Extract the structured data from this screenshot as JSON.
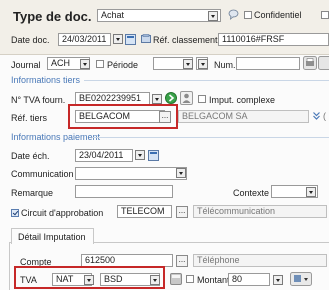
{
  "header": {
    "title": "Type de doc.",
    "doc_type_value": "Achat",
    "confidential_label": "Confidentiel",
    "date_doc_label": "Date doc.",
    "date_doc_value": "24/03/2011",
    "ref_classement_label": "Réf. classement",
    "ref_classement_value": "1110016#FRSF"
  },
  "journal_row": {
    "journal_label": "Journal",
    "journal_value": "ACH",
    "periode_label": "Période",
    "num_label": "Num."
  },
  "tiers": {
    "section_label": "Informations tiers",
    "tva_label": "N° TVA fourn.",
    "tva_value": "BE0202239951",
    "imput_label": "Imput. complexe",
    "ref_label": "Réf. tiers",
    "ref_value": "BELGACOM",
    "ref_name": "BELGACOM SA"
  },
  "paiement": {
    "section_label": "Informations paiement",
    "date_ech_label": "Date éch.",
    "date_ech_value": "23/04/2011",
    "communication_label": "Communication",
    "remarque_label": "Remarque",
    "contexte_label": "Contexte",
    "circuit_label": "Circuit d'approbation",
    "circuit_value": "TELECOM",
    "circuit_desc": "Télécommunication"
  },
  "imputation": {
    "tab_label": "Détail Imputation",
    "compte_label": "Compte",
    "compte_value": "612500",
    "compte_desc": "Téléphone",
    "tva_label": "TVA",
    "tva_code": "NAT",
    "tva_sub": "BSD",
    "montant_label": "Montant",
    "montant_value": "80"
  }
}
